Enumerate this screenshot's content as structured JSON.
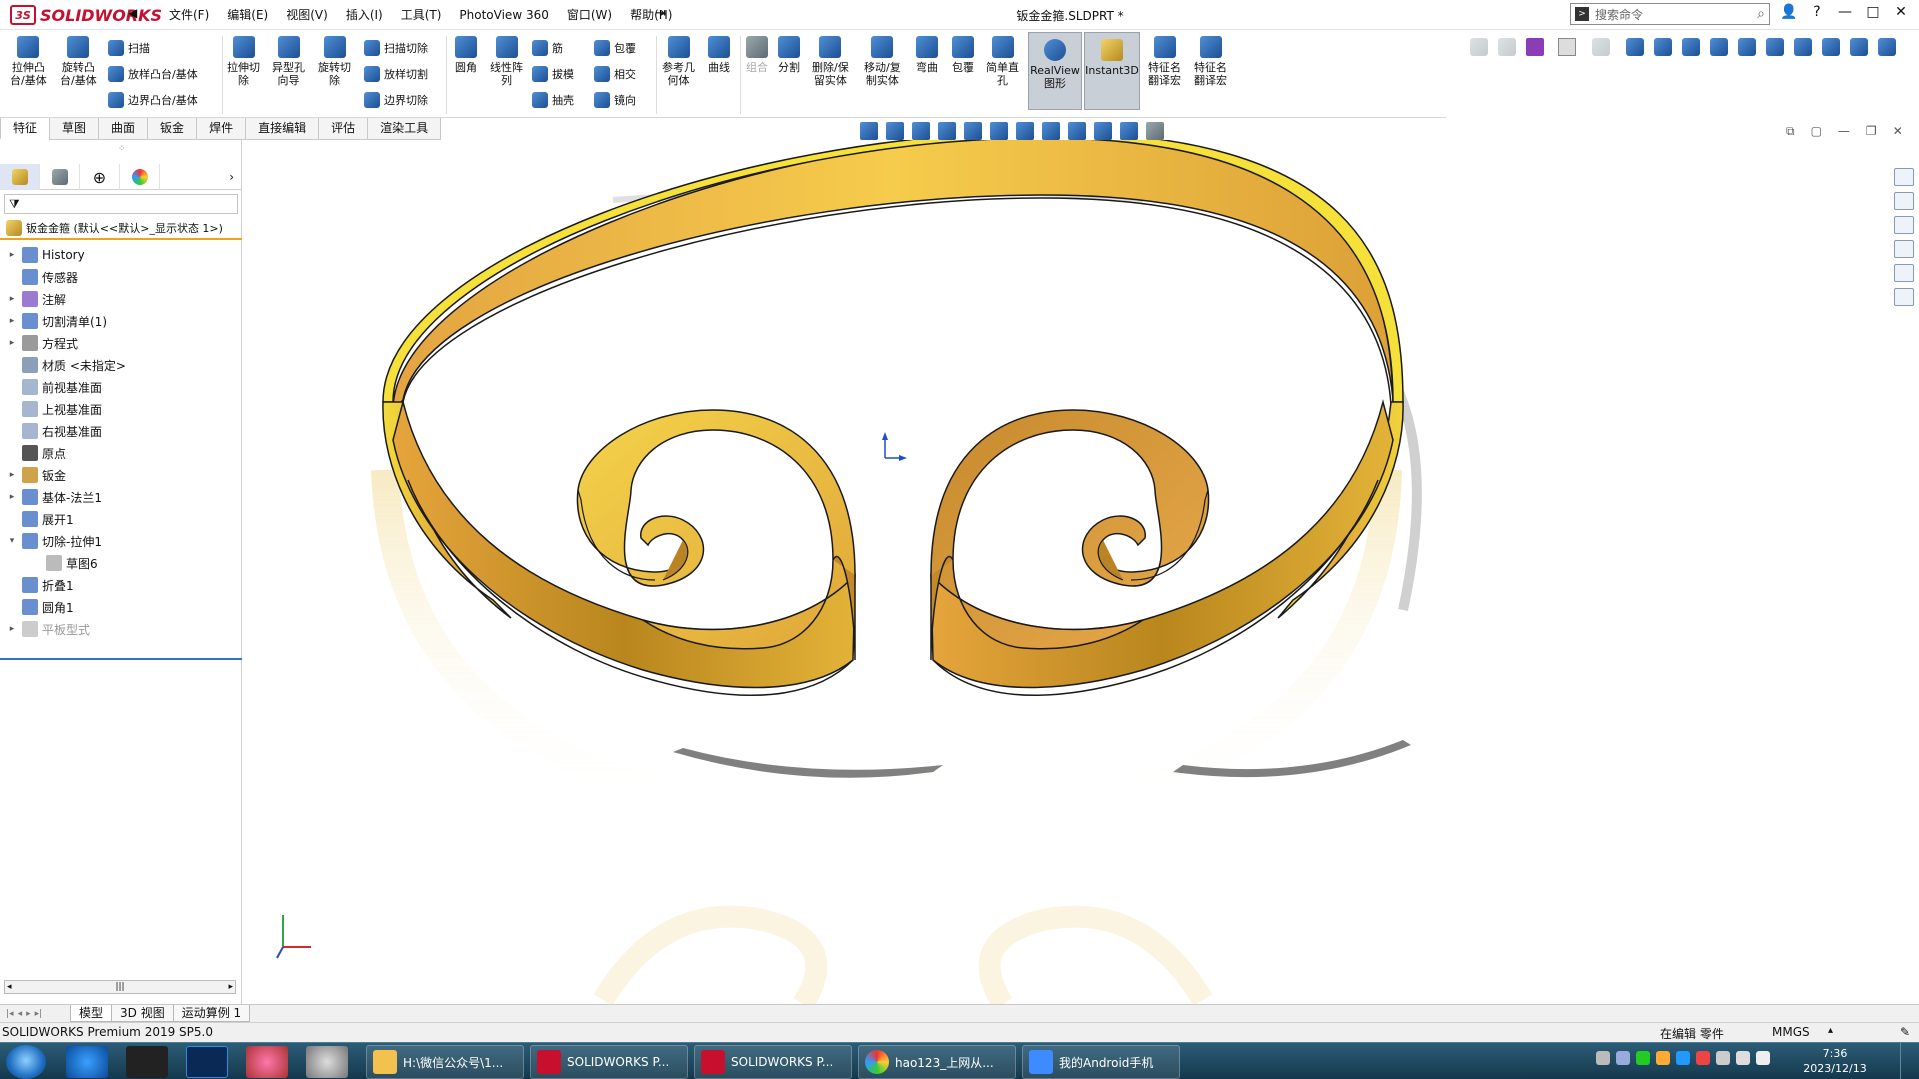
{
  "titlebar": {
    "logo_text": "SOLIDWORKS",
    "logo_badge": "3S",
    "menu": [
      "文件(F)",
      "编辑(E)",
      "视图(V)",
      "插入(I)",
      "工具(T)",
      "PhotoView 360",
      "窗口(W)",
      "帮助(H)"
    ],
    "document_title": "钣金金箍.SLDPRT *",
    "search_placeholder": "搜索命令",
    "controls": [
      "?",
      "—",
      "□",
      "✕"
    ]
  },
  "command_manager": {
    "tools": [
      "拉伸凸\n台/基体",
      "旋转凸\n台/基体",
      "扫描",
      "放样凸台/基体",
      "边界凸台/基体",
      "拉伸切\n除",
      "异型孔\n向导",
      "旋转切\n除",
      "扫描切除",
      "放样切割",
      "边界切除",
      "圆角",
      "线性阵\n列",
      "筋",
      "拔模",
      "抽壳",
      "包覆",
      "相交",
      "镜向",
      "参考几\n何体",
      "曲线",
      "组合",
      "分割",
      "删除/保\n留实体",
      "移动/复\n制实体",
      "弯曲",
      "包覆",
      "简单直\n孔",
      "RealView\n图形",
      "Instant3D",
      "特征名\n翻译宏",
      "特征名\n翻译宏"
    ],
    "tabs": [
      "特征",
      "草图",
      "曲面",
      "钣金",
      "焊件",
      "直接编辑",
      "评估",
      "渲染工具"
    ],
    "active_tab": "特征"
  },
  "feature_tree": {
    "root": "钣金金箍 (默认<<默认>_显示状态 1>)",
    "items": [
      {
        "label": "History",
        "expandable": true,
        "indent": 0
      },
      {
        "label": "传感器",
        "expandable": false,
        "indent": 0
      },
      {
        "label": "注解",
        "expandable": true,
        "indent": 0
      },
      {
        "label": "切割清单(1)",
        "expandable": true,
        "indent": 0
      },
      {
        "label": "方程式",
        "expandable": true,
        "indent": 0
      },
      {
        "label": "材质 <未指定>",
        "expandable": false,
        "indent": 0
      },
      {
        "label": "前视基准面",
        "expandable": false,
        "indent": 0
      },
      {
        "label": "上视基准面",
        "expandable": false,
        "indent": 0
      },
      {
        "label": "右视基准面",
        "expandable": false,
        "indent": 0
      },
      {
        "label": "原点",
        "expandable": false,
        "indent": 0
      },
      {
        "label": "钣金",
        "expandable": true,
        "indent": 0
      },
      {
        "label": "基体-法兰1",
        "expandable": true,
        "indent": 0
      },
      {
        "label": "展开1",
        "expandable": false,
        "indent": 0
      },
      {
        "label": "切除-拉伸1",
        "expandable": true,
        "expanded": true,
        "indent": 0
      },
      {
        "label": "草图6",
        "expandable": false,
        "indent": 1
      },
      {
        "label": "折叠1",
        "expandable": false,
        "indent": 0
      },
      {
        "label": "圆角1",
        "expandable": false,
        "indent": 0
      },
      {
        "label": "平板型式",
        "expandable": true,
        "indent": 0,
        "dim": true
      }
    ]
  },
  "bottom_tabs": [
    "模型",
    "3D 视图",
    "运动算例 1"
  ],
  "active_bottom_tab": "模型",
  "status": {
    "product": "SOLIDWORKS Premium 2019 SP5.0",
    "mode": "在编辑 零件",
    "units": "MMGS"
  },
  "taskbar": {
    "apps": [
      {
        "label": "H:\\微信公众号\\1...",
        "icon": "folder-icon"
      },
      {
        "label": "SOLIDWORKS P...",
        "icon": "solidworks-icon"
      },
      {
        "label": "SOLIDWORKS P...",
        "icon": "solidworks-icon"
      },
      {
        "label": "hao123_上网从...",
        "icon": "browser-icon"
      },
      {
        "label": "我的Android手机",
        "icon": "phone-icon"
      }
    ],
    "clock_time": "7:36",
    "clock_date": "2023/12/13"
  },
  "colors": {
    "accent": "#f0a21a",
    "selection_blue": "#2e75c8",
    "model_gold": "#e4b43a",
    "model_edge": "#1a1a1a"
  }
}
